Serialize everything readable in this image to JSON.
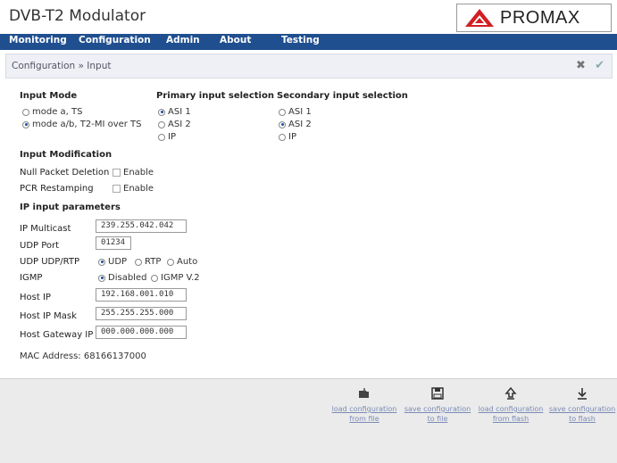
{
  "app": {
    "title": "DVB-T2 Modulator",
    "brand": "PROMAX",
    "brand_color": "#d11f24"
  },
  "menu": [
    {
      "label": "Monitoring"
    },
    {
      "label": "Configuration"
    },
    {
      "label": "Admin"
    },
    {
      "label": "About"
    },
    {
      "label": "Testing"
    }
  ],
  "breadcrumb": "Configuration » Input",
  "actions": {
    "cancel_icon": "✖",
    "apply_icon": "✔"
  },
  "input_mode": {
    "title": "Input Mode",
    "options": [
      {
        "label": "mode a, TS",
        "selected": false
      },
      {
        "label": "mode a/b, T2-MI over TS",
        "selected": true
      }
    ]
  },
  "primary": {
    "title": "Primary input selection",
    "options": [
      {
        "label": "ASI 1",
        "selected": true
      },
      {
        "label": "ASI 2",
        "selected": false
      },
      {
        "label": "IP",
        "selected": false
      }
    ]
  },
  "secondary": {
    "title": "Secondary input selection",
    "options": [
      {
        "label": "ASI 1",
        "selected": false
      },
      {
        "label": "ASI 2",
        "selected": true
      },
      {
        "label": "IP",
        "selected": false
      }
    ]
  },
  "modification": {
    "title": "Input Modification",
    "null_packet": {
      "label": "Null Packet Deletion",
      "check_label": "Enable",
      "checked": false
    },
    "pcr": {
      "label": "PCR Restamping",
      "check_label": "Enable",
      "checked": false
    }
  },
  "ip": {
    "title": "IP input parameters",
    "multicast": {
      "label": "IP Multicast",
      "value": "239.255.042.042"
    },
    "udp_port": {
      "label": "UDP Port",
      "value": "01234"
    },
    "udp_rtp": {
      "label": "UDP UDP/RTP",
      "options": [
        {
          "label": "UDP",
          "selected": true
        },
        {
          "label": "RTP",
          "selected": false
        },
        {
          "label": "Auto",
          "selected": false
        }
      ]
    },
    "igmp": {
      "label": "IGMP",
      "options": [
        {
          "label": "Disabled",
          "selected": true
        },
        {
          "label": "IGMP V.2",
          "selected": false
        }
      ]
    },
    "host_ip": {
      "label": "Host IP",
      "value": "192.168.001.010"
    },
    "host_mask": {
      "label": "Host IP Mask",
      "value": "255.255.255.000"
    },
    "host_gw": {
      "label": "Host Gateway IP",
      "value": "000.000.000.000"
    }
  },
  "mac": "MAC Address: 68166137000",
  "footer": [
    {
      "icon": "load-file-icon",
      "line1": "load configuration",
      "line2": "from file"
    },
    {
      "icon": "save-file-icon",
      "line1": "save configuration",
      "line2": "to file"
    },
    {
      "icon": "load-flash-icon",
      "line1": "load configuration",
      "line2": "from flash"
    },
    {
      "icon": "save-flash-icon",
      "line1": "save configuration",
      "line2": "to flash"
    }
  ]
}
